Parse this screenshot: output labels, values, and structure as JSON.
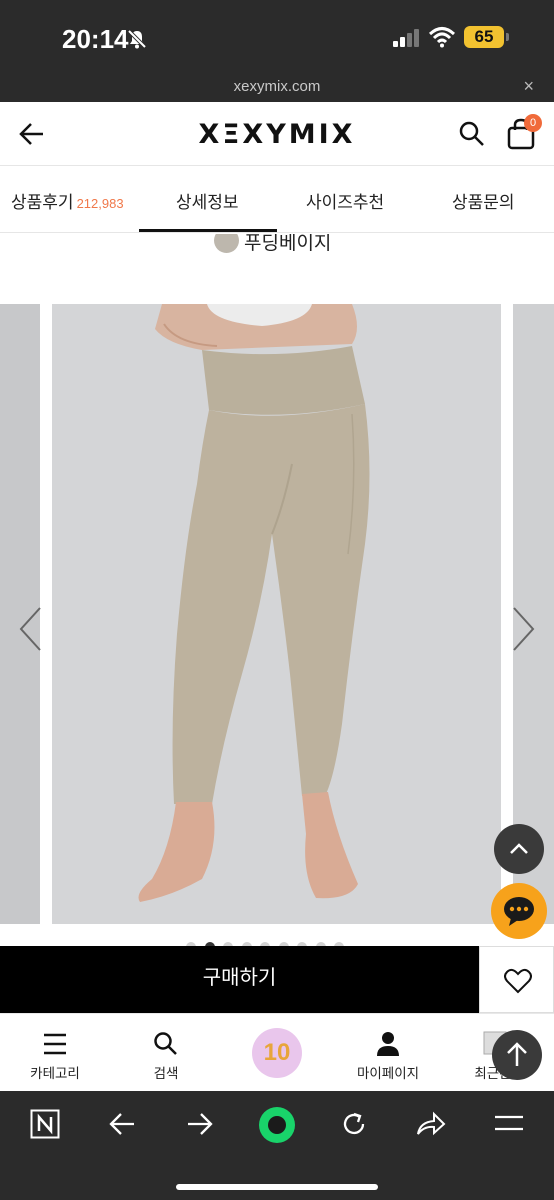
{
  "status_bar": {
    "time": "20:14",
    "battery": "65"
  },
  "browser": {
    "url": "xexymix.com",
    "close": "×"
  },
  "header": {
    "logo": "XΞXYMIX",
    "cart_count": "0"
  },
  "tabs": [
    {
      "label": "상품후기",
      "count": "212,983"
    },
    {
      "label": "상세정보"
    },
    {
      "label": "사이즈추천"
    },
    {
      "label": "상품문의"
    }
  ],
  "product": {
    "color_label": "푸딩베이지",
    "swatch_color": "#bdb7ad",
    "gallery_index": 2,
    "gallery_total": 9
  },
  "actions": {
    "buy_label": "구매하기"
  },
  "bottom_nav": [
    {
      "label": "카테고리",
      "icon": "menu-icon"
    },
    {
      "label": "검색",
      "icon": "search-icon"
    },
    {
      "label": "10",
      "icon": "event-icon"
    },
    {
      "label": "마이페이지",
      "icon": "person-icon"
    },
    {
      "label": "최근본",
      "icon": "recent-icon"
    }
  ],
  "colors": {
    "accent": "#f0784a",
    "chat": "#f7a21b",
    "buy": "#000000"
  }
}
